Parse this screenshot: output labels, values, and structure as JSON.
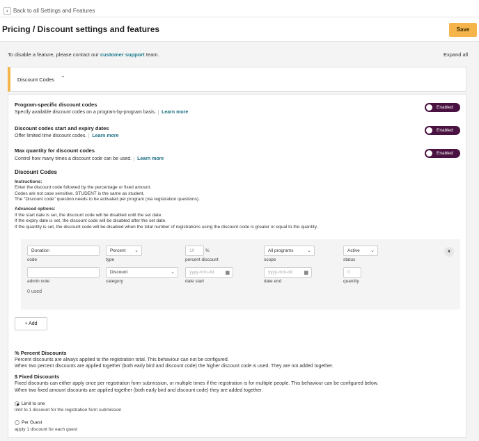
{
  "nav": {
    "back_icon": "‹",
    "back_label": "Back to all Settings and Features"
  },
  "header": {
    "title": "Pricing / Discount settings and features",
    "save_label": "Save"
  },
  "info": {
    "prefix": "To disable a feature, please contact our ",
    "link": "customer support",
    "suffix": " team.",
    "expand_all": "Expand all"
  },
  "section": {
    "title": "Discount Codes",
    "chevron": "⌃"
  },
  "features": [
    {
      "title": "Program-specific discount codes",
      "desc": "Specify available discount codes on a program-by-program basis.",
      "learn_more": "Learn more",
      "toggle": "Enabled"
    },
    {
      "title": "Discount codes start and expiry dates",
      "desc": "Offer limited time discount codes.",
      "learn_more": "Learn more",
      "toggle": "Enabled"
    },
    {
      "title": "Max quantity for discount codes",
      "desc": "Control how many times a discount code can be used.",
      "learn_more": "Learn more",
      "toggle": "Enabled"
    }
  ],
  "discount_codes": {
    "heading": "Discount Codes",
    "instructions_label": "Instructions:",
    "instructions": [
      "Enter the discount code followed by the percentage or fixed amount.",
      "Codes are not case sensitive. STUDENT is the same as student.",
      "The \"Discount code\" question needs to be activated per program (via registration questions)."
    ],
    "advanced_label": "Advanced options:",
    "advanced": [
      "If the start date is set, the discount code will be disabled until the set date.",
      "If the expiry date is set, the discount code will be disabled after the set date.",
      "If the quantity is set, the discount code will be disabled when the total number of registrations using the discount code is greater or equal to the quantity."
    ]
  },
  "code_row": {
    "code_value": "Donation",
    "code_label": "code",
    "type_value": "Percent",
    "type_label": "type",
    "percent_placeholder": "10",
    "percent_unit": "%",
    "percent_label": "percent discount",
    "scope_value": "All programs",
    "scope_label": "scope",
    "status_value": "Active",
    "status_label": "status",
    "remove": "x",
    "admin_note_label": "admin note",
    "category_value": "Discount",
    "category_label": "category",
    "date_start_placeholder": "yyyy-mm-dd",
    "date_start_label": "date start",
    "date_end_placeholder": "yyyy-mm-dd",
    "date_end_label": "date end",
    "quantity_placeholder": "0",
    "quantity_label": "quantity",
    "used": "0 used"
  },
  "add_label": "+ Add",
  "percent_discounts": {
    "title": "% Percent Discounts",
    "lines": [
      "Percent discounts are always applied to the registration total. This behaviour can not be configured.",
      "When two percent discounts are applied together (both early bird and discount code) the higher discount code is used. They are not added together."
    ]
  },
  "fixed_discounts": {
    "title": "$ Fixed Discounts",
    "lines": [
      "Fixed discounts can either apply once per registration form submission, or multiple times if the registration is for multiple people. This behaviour can be configured below.",
      "When two fixed amount discounts are applied together (both early bird and discount code) they are added together."
    ]
  },
  "options": [
    {
      "label": "Limit to one",
      "desc": "limit to 1 discount for the registration form submission",
      "selected": true
    },
    {
      "label": "Per Guest",
      "desc": "apply 1 discount for each guest",
      "selected": false
    }
  ],
  "colors": {
    "accent": "#f5b54a",
    "toggle_bg": "#4a1240",
    "link": "#1a6d80"
  },
  "icons": {
    "select_chevron": "⌄",
    "calendar": "▦"
  }
}
